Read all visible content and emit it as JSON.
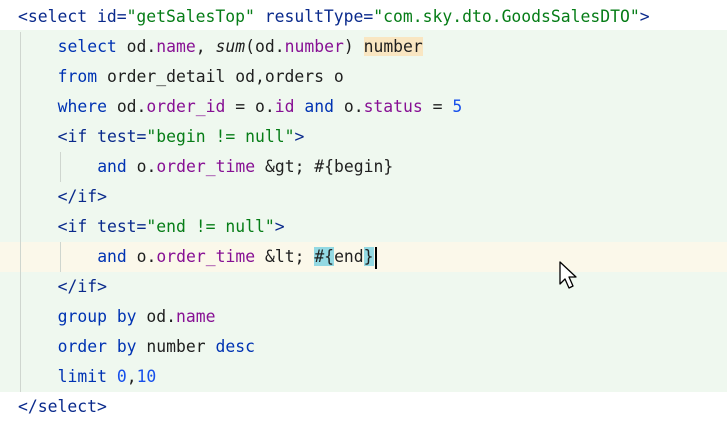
{
  "editor": {
    "lines": [
      {
        "indent": 0,
        "tokens": [
          {
            "t": "<select ",
            "c": "tag"
          },
          {
            "t": "id=",
            "c": "attr"
          },
          {
            "t": "\"getSalesTop\"",
            "c": "str"
          },
          {
            "t": " resultType=",
            "c": "attr"
          },
          {
            "t": "\"com.sky.dto.GoodsSalesDTO\"",
            "c": "str"
          },
          {
            "t": ">",
            "c": "tag"
          }
        ]
      },
      {
        "indent": 1,
        "tokens": [
          {
            "t": "select ",
            "c": "kw"
          },
          {
            "t": "od.",
            "c": "txt"
          },
          {
            "t": "name",
            "c": "field"
          },
          {
            "t": ", ",
            "c": "txt"
          },
          {
            "t": "sum",
            "c": "fn"
          },
          {
            "t": "(od.",
            "c": "txt"
          },
          {
            "t": "number",
            "c": "field"
          },
          {
            "t": ") ",
            "c": "txt"
          },
          {
            "t": "number",
            "c": "txt",
            "hl": "alias"
          }
        ]
      },
      {
        "indent": 1,
        "tokens": [
          {
            "t": "from ",
            "c": "kw"
          },
          {
            "t": "order_detail od,orders o",
            "c": "txt"
          }
        ]
      },
      {
        "indent": 1,
        "tokens": [
          {
            "t": "where ",
            "c": "kw"
          },
          {
            "t": "od.",
            "c": "txt"
          },
          {
            "t": "order_id",
            "c": "field"
          },
          {
            "t": " = o.",
            "c": "txt"
          },
          {
            "t": "id",
            "c": "field"
          },
          {
            "t": " ",
            "c": "txt"
          },
          {
            "t": "and",
            "c": "kw"
          },
          {
            "t": " o.",
            "c": "txt"
          },
          {
            "t": "status",
            "c": "field"
          },
          {
            "t": " = ",
            "c": "txt"
          },
          {
            "t": "5",
            "c": "num"
          }
        ]
      },
      {
        "indent": 1,
        "tokens": [
          {
            "t": "<if ",
            "c": "tag"
          },
          {
            "t": "test=",
            "c": "attr"
          },
          {
            "t": "\"begin != null\"",
            "c": "str"
          },
          {
            "t": ">",
            "c": "tag"
          }
        ]
      },
      {
        "indent": 2,
        "tokens": [
          {
            "t": "and",
            "c": "kw"
          },
          {
            "t": " o.",
            "c": "txt"
          },
          {
            "t": "order_time",
            "c": "field"
          },
          {
            "t": " &gt; #{begin}",
            "c": "txt"
          }
        ]
      },
      {
        "indent": 1,
        "tokens": [
          {
            "t": "</if>",
            "c": "tag"
          }
        ]
      },
      {
        "indent": 1,
        "tokens": [
          {
            "t": "<if ",
            "c": "tag"
          },
          {
            "t": "test=",
            "c": "attr"
          },
          {
            "t": "\"end != null\"",
            "c": "str"
          },
          {
            "t": ">",
            "c": "tag"
          }
        ]
      },
      {
        "indent": 2,
        "current": true,
        "caret": true,
        "tokens": [
          {
            "t": "and",
            "c": "kw"
          },
          {
            "t": " o.",
            "c": "txt"
          },
          {
            "t": "order_time",
            "c": "field"
          },
          {
            "t": " &lt; ",
            "c": "txt"
          },
          {
            "t": "#{",
            "c": "txt",
            "hl": "match"
          },
          {
            "t": "end",
            "c": "txt"
          },
          {
            "t": "}",
            "c": "txt",
            "hl": "match"
          }
        ]
      },
      {
        "indent": 1,
        "tokens": [
          {
            "t": "</if>",
            "c": "tag"
          }
        ]
      },
      {
        "indent": 1,
        "tokens": [
          {
            "t": "group ",
            "c": "kw"
          },
          {
            "t": "by",
            "c": "kw"
          },
          {
            "t": " od.",
            "c": "txt"
          },
          {
            "t": "name",
            "c": "field"
          }
        ]
      },
      {
        "indent": 1,
        "tokens": [
          {
            "t": "order ",
            "c": "kw"
          },
          {
            "t": "by",
            "c": "kw"
          },
          {
            "t": " number ",
            "c": "txt"
          },
          {
            "t": "desc",
            "c": "kw"
          }
        ]
      },
      {
        "indent": 1,
        "tokens": [
          {
            "t": "limit ",
            "c": "kw"
          },
          {
            "t": "0",
            "c": "num"
          },
          {
            "t": ",",
            "c": "txt"
          },
          {
            "t": "10",
            "c": "num"
          }
        ]
      },
      {
        "indent": 0,
        "tokens": [
          {
            "t": "</select>",
            "c": "tag"
          }
        ]
      }
    ]
  },
  "colors": {
    "tag": "#0a2a8c",
    "string": "#067d17",
    "keyword": "#0033b3",
    "field": "#871094",
    "number": "#1750eb",
    "block_background": "#eff8ef",
    "current_line": "#fbf8ea"
  },
  "icons": {
    "mouse": "arrow-cursor-icon"
  }
}
